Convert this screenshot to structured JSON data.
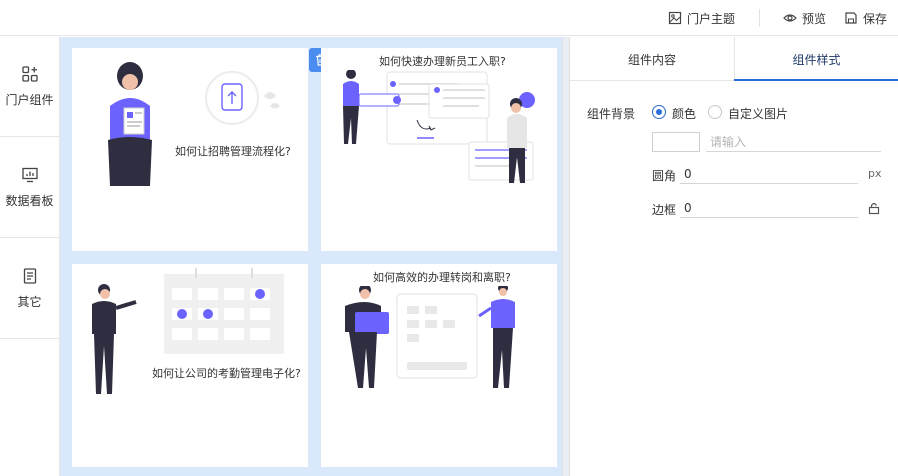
{
  "topbar": {
    "theme_label": "门户主题",
    "preview_label": "预览",
    "save_label": "保存"
  },
  "sidebar": {
    "items": [
      {
        "label": "门户组件",
        "icon": "grid-plus-icon"
      },
      {
        "label": "数据看板",
        "icon": "monitor-chart-icon"
      },
      {
        "label": "其它",
        "icon": "document-icon"
      }
    ]
  },
  "cards": [
    {
      "title": "如何让招聘管理流程化?"
    },
    {
      "title": "如何快速办理新员工入职?"
    },
    {
      "title": "如何让公司的考勤管理电子化?"
    },
    {
      "title": "如何高效的办理转岗和离职?"
    }
  ],
  "panel": {
    "tabs": [
      {
        "label": "组件内容",
        "active": false
      },
      {
        "label": "组件样式",
        "active": true
      }
    ],
    "background_label": "组件背景",
    "bg_options": [
      {
        "label": "颜色",
        "selected": true
      },
      {
        "label": "自定义图片",
        "selected": false
      }
    ],
    "color_placeholder": "请输入",
    "radius_label": "圆角",
    "radius_value": "0",
    "radius_unit": "px",
    "border_label": "边框",
    "border_value": "0"
  },
  "colors": {
    "accent": "#2a6cd8",
    "canvas_bg": "#d9e8fb",
    "illustration_purple": "#6c63ff",
    "delete_button": "#4a8cf0"
  }
}
